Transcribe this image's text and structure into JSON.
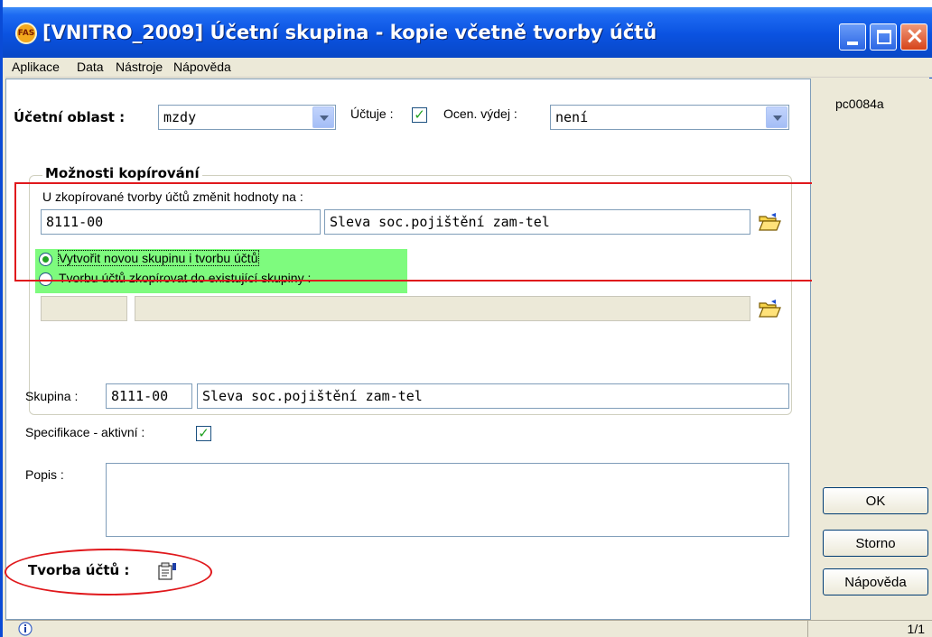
{
  "window": {
    "title": "[VNITRO_2009] Účetní skupina - kopie včetně tvorby účtů",
    "app_icon_text": "FAS"
  },
  "menu": {
    "items": [
      "Aplikace",
      "Data",
      "Nástroje",
      "Nápověda"
    ]
  },
  "form": {
    "area_label": "Účetní oblast :",
    "area_value": "mzdy",
    "ucetuje_label": "Účtuje :",
    "ucetuje_checked": "✓",
    "ocen_label": "Ocen. výdej :",
    "ocen_value": "není",
    "copy_group": {
      "title": "Možnosti kopírování",
      "change_label": "U zkopírované tvorby účtů změnit hodnoty na :",
      "code_value": "8111-00",
      "name_value": "Sleva soc.pojištění zam-tel",
      "radio1_label": "Vytvořit novou skupinu i tvorbu účtů",
      "radio1_selected": true,
      "radio2_label": "Tvorbu účtů zkopírovat do existující skupiny :",
      "radio2_selected": false,
      "existing_code": "",
      "existing_name": ""
    },
    "skupina_label": "Skupina :",
    "skupina_code": "8111-00",
    "skupina_name": "Sleva soc.pojištění zam-tel",
    "spec_label": "Specifikace - aktivní :",
    "spec_checked": "✓",
    "popis_label": "Popis :",
    "popis_value": "",
    "tvorba_label": "Tvorba účtů :"
  },
  "right_panel": {
    "code": "pc0084a",
    "ok_label": "OK",
    "storno_label": "Storno",
    "help_label": "Nápověda"
  },
  "status": {
    "page": "1/1"
  },
  "colors": {
    "titlebar": "#0a52e0",
    "highlight_green": "#7efb7e",
    "annotation_red": "#e0181c"
  }
}
